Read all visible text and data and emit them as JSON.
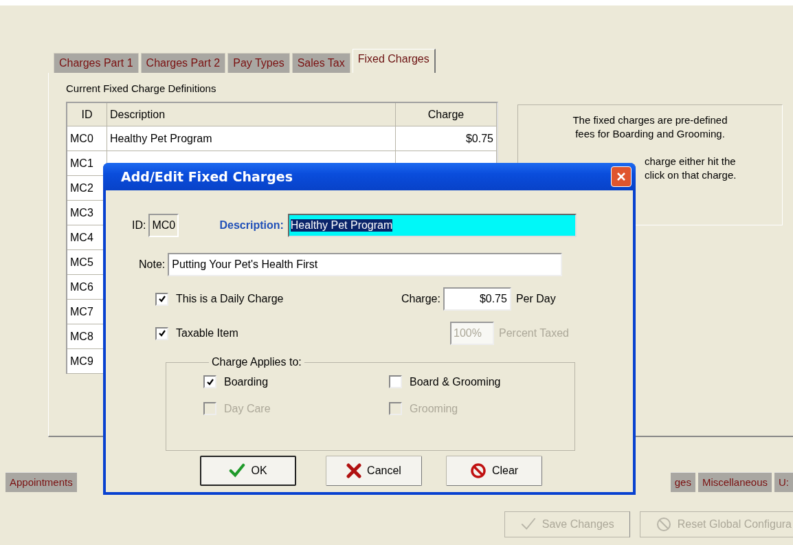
{
  "tabs": [
    {
      "label": "Charges Part 1",
      "selected": false
    },
    {
      "label": "Charges Part 2",
      "selected": false
    },
    {
      "label": "Pay Types",
      "selected": false
    },
    {
      "label": "Sales Tax",
      "selected": false
    },
    {
      "label": "Fixed Charges",
      "selected": true
    }
  ],
  "table": {
    "caption": "Current Fixed Charge Definitions",
    "columns": [
      "ID",
      "Description",
      "Charge"
    ],
    "rows": [
      {
        "id": "MC0",
        "description": "Healthy Pet Program",
        "charge": "$0.75"
      },
      {
        "id": "MC1"
      },
      {
        "id": "MC2"
      },
      {
        "id": "MC3"
      },
      {
        "id": "MC4"
      },
      {
        "id": "MC5"
      },
      {
        "id": "MC6"
      },
      {
        "id": "MC7"
      },
      {
        "id": "MC8"
      },
      {
        "id": "MC9"
      }
    ]
  },
  "info_lines": [
    {
      "text": "The fixed charges are pre-defined",
      "kind": "full"
    },
    {
      "text": "fees for Boarding and Grooming.",
      "kind": "full"
    },
    {
      "text": "charge either hit the",
      "kind": "covered"
    },
    {
      "text": "click on that charge.",
      "kind": "covered"
    }
  ],
  "bottom_tabs_left": [
    {
      "label": "Appointments",
      "selected": false
    }
  ],
  "bottom_tabs_right": [
    {
      "label": "ges",
      "selected": false
    },
    {
      "label": "Miscellaneous",
      "selected": false
    },
    {
      "label": "U:",
      "selected": false
    }
  ],
  "bottom_buttons": [
    {
      "label": "Save Changes",
      "kind": "save",
      "disabled": true
    },
    {
      "label": "Reset Global Configura",
      "kind": "reset",
      "disabled": true
    }
  ],
  "dialog": {
    "title": "Add/Edit Fixed Charges",
    "id_label": "ID:",
    "id_value": "MC0",
    "description_label": "Description:",
    "description_value": "Healthy Pet Program",
    "description_selected": true,
    "note_label": "Note:",
    "note_value": "Putting Your Pet's Health First",
    "daily": {
      "label": "This is a Daily Charge",
      "checked": true,
      "disabled": false
    },
    "charge_label": "Charge:",
    "charge_value": "$0.75",
    "charge_unit": "Per Day",
    "taxable": {
      "label": "Taxable Item",
      "checked": true,
      "disabled": false
    },
    "percent": {
      "value": "100%",
      "label": "Percent Taxed",
      "disabled": true
    },
    "applies": {
      "legend": "Charge Applies to:",
      "options": [
        {
          "label": "Boarding",
          "checked": true,
          "disabled": false
        },
        {
          "label": "Board & Grooming",
          "checked": false,
          "disabled": false
        },
        {
          "label": "Day Care",
          "checked": false,
          "disabled": true
        },
        {
          "label": "Grooming",
          "checked": false,
          "disabled": true
        }
      ]
    },
    "buttons": [
      {
        "label": "OK",
        "kind": "ok",
        "default": true
      },
      {
        "label": "Cancel",
        "kind": "cancel",
        "default": false
      },
      {
        "label": "Clear",
        "kind": "clear",
        "default": false
      }
    ]
  }
}
